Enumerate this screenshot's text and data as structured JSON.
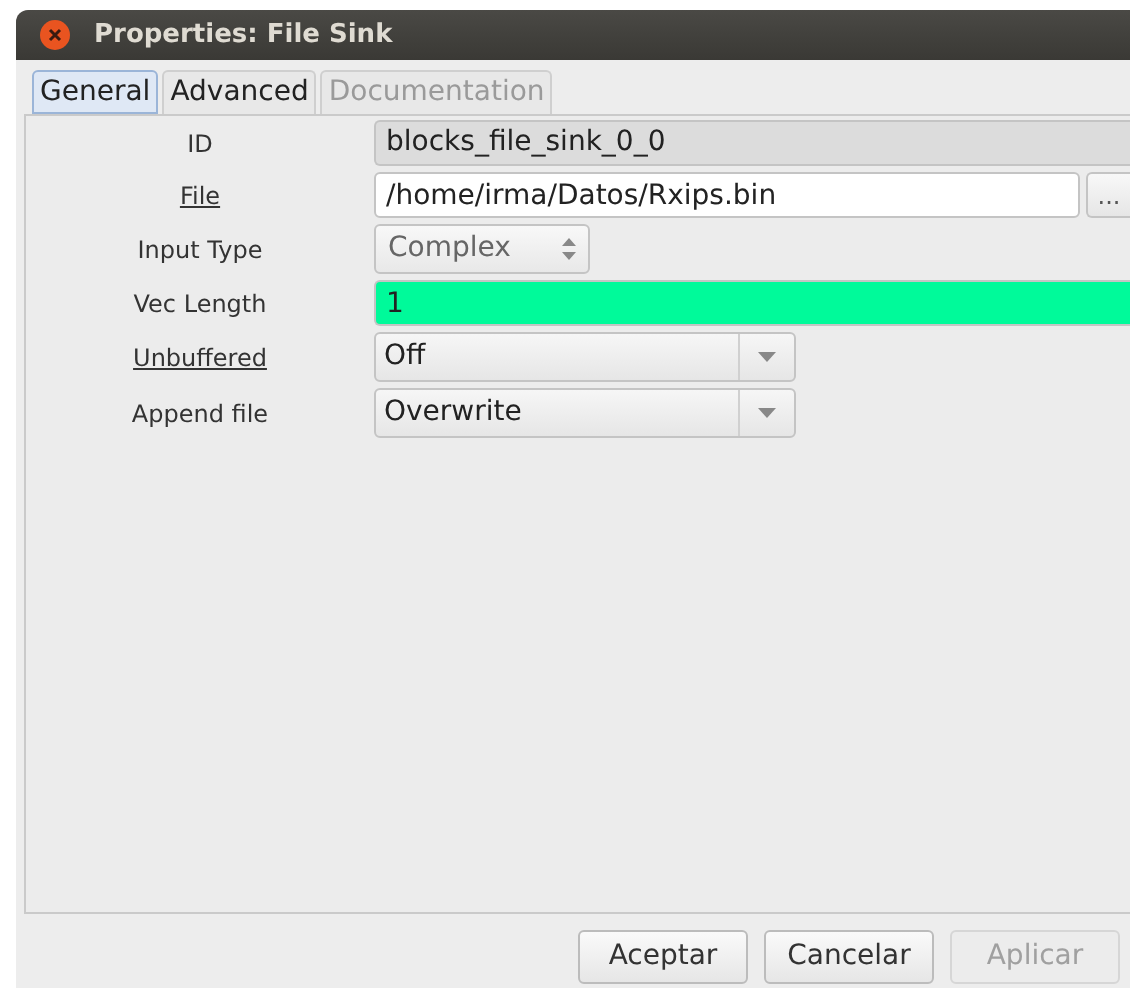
{
  "window": {
    "title": "Properties: File Sink"
  },
  "tabs": [
    {
      "label": "General",
      "selected": true,
      "disabled": false
    },
    {
      "label": "Advanced",
      "selected": false,
      "disabled": false
    },
    {
      "label": "Documentation",
      "selected": false,
      "disabled": true
    }
  ],
  "fields": [
    {
      "label": "ID",
      "underlined": false,
      "kind": "readonly",
      "value": "blocks_file_sink_0_0"
    },
    {
      "label": "File",
      "underlined": true,
      "kind": "file",
      "value": "/home/irma/Datos/Rxips.bin",
      "browse": "..."
    },
    {
      "label": "Input Type",
      "underlined": false,
      "kind": "spin",
      "value": "Complex"
    },
    {
      "label": "Vec Length",
      "underlined": false,
      "kind": "highlight",
      "value": "1"
    },
    {
      "label": "Unbuffered",
      "underlined": true,
      "kind": "dropdown",
      "value": "Off"
    },
    {
      "label": "Append file",
      "underlined": false,
      "kind": "dropdown",
      "value": "Overwrite"
    }
  ],
  "buttons": [
    {
      "label": "Aceptar",
      "disabled": false
    },
    {
      "label": "Cancelar",
      "disabled": false
    },
    {
      "label": "Aplicar",
      "disabled": true
    }
  ]
}
